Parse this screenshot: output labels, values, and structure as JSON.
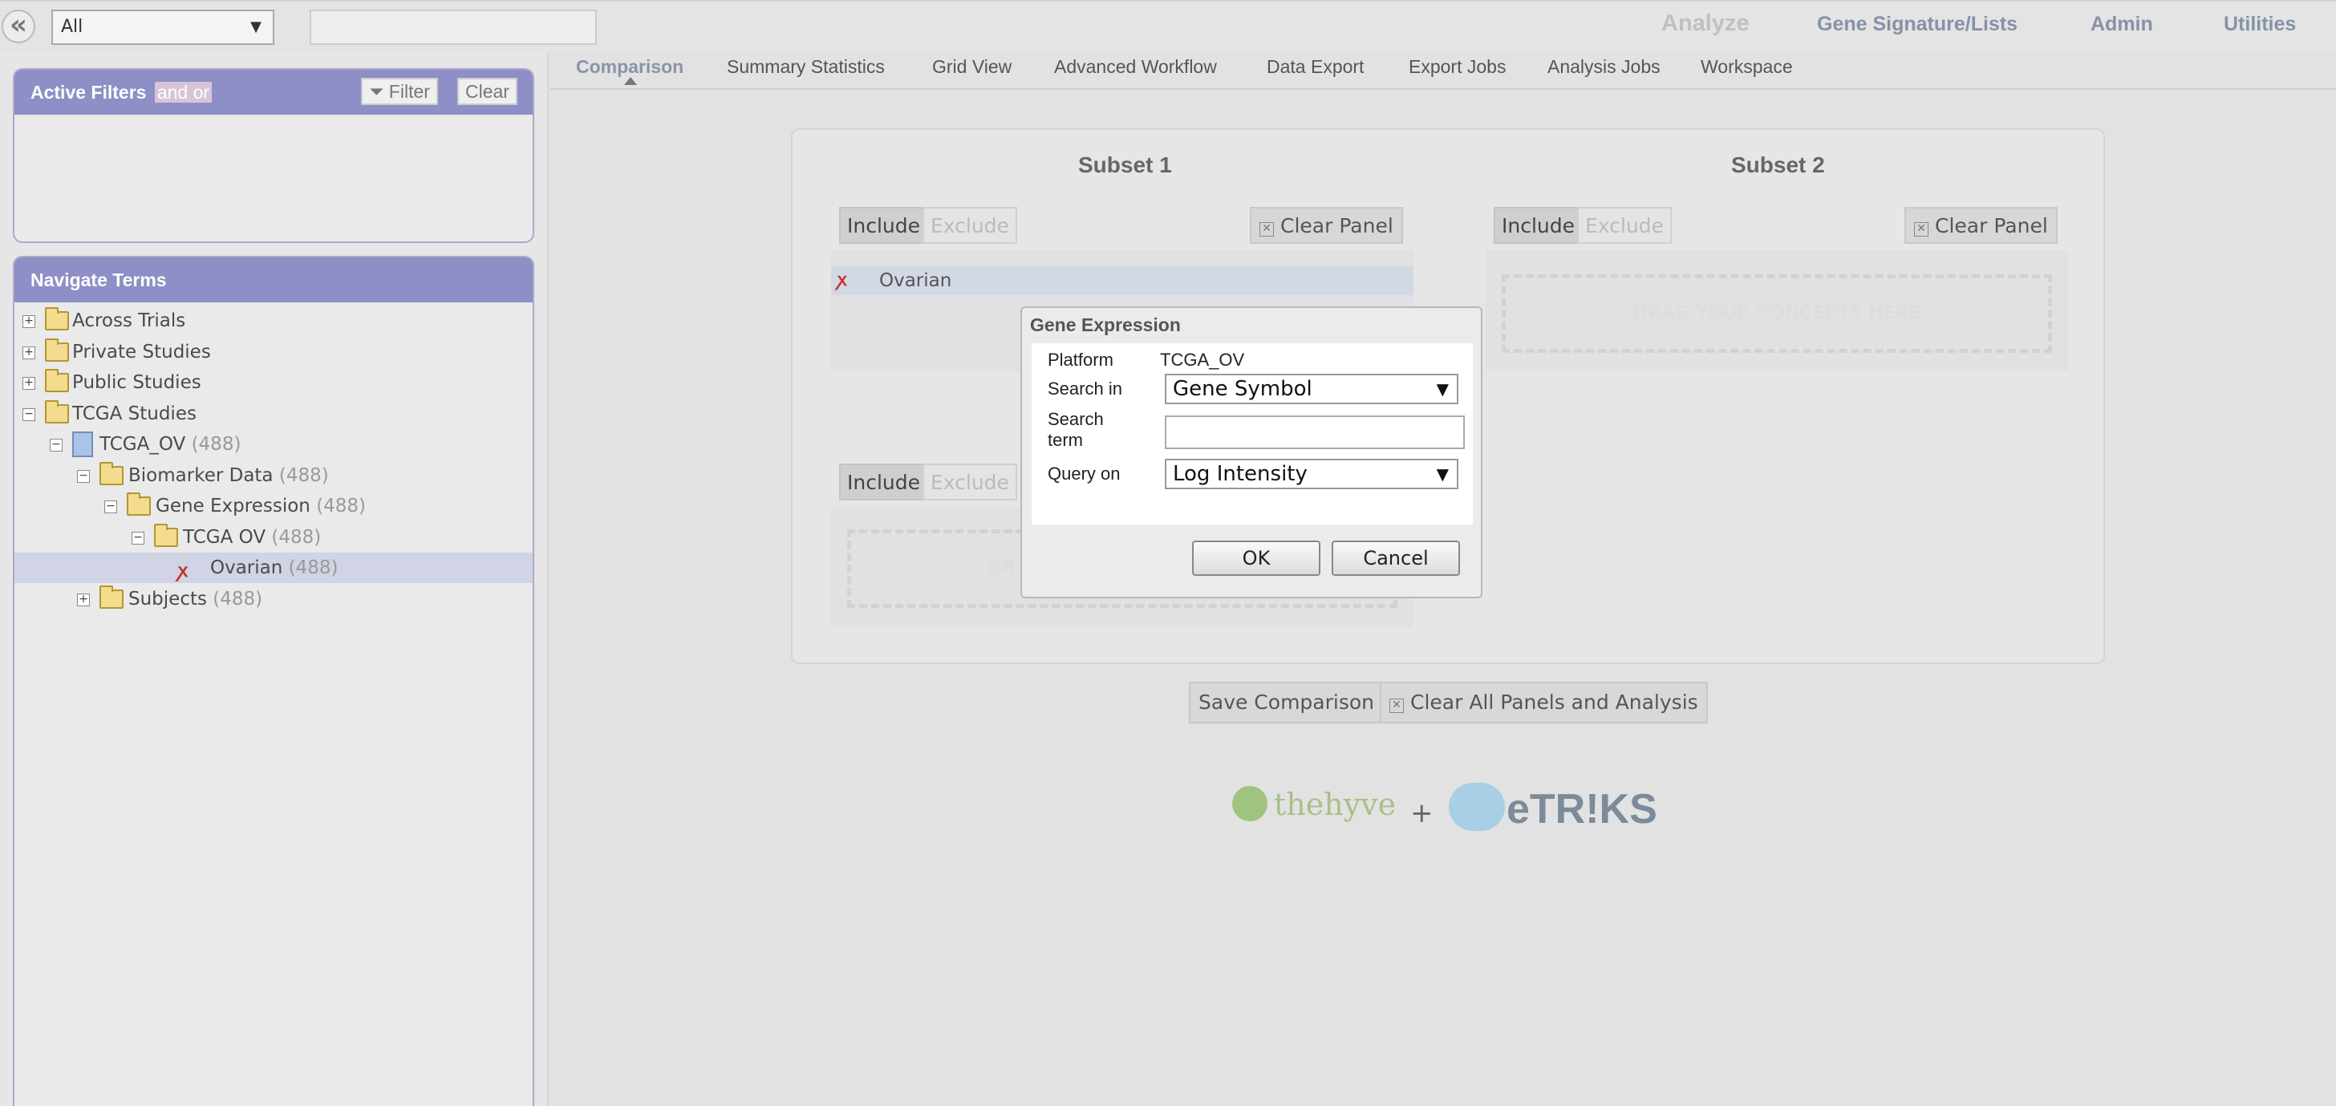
{
  "topbar": {
    "collapse_glyph": "«",
    "category_select": "All",
    "nav": {
      "analyze": "Analyze",
      "gene_signature": "Gene Signature/Lists",
      "admin": "Admin",
      "utilities": "Utilities"
    }
  },
  "active_filters": {
    "title": "Active Filters",
    "andor": "and or",
    "filter_btn": "Filter",
    "clear_btn": "Clear"
  },
  "navigate_terms": {
    "title": "Navigate Terms",
    "tree": [
      {
        "label": "Across Trials",
        "count": ""
      },
      {
        "label": "Private Studies",
        "count": ""
      },
      {
        "label": "Public Studies",
        "count": ""
      },
      {
        "label": "TCGA Studies",
        "count": ""
      },
      {
        "label": "TCGA_OV",
        "count": "(488)"
      },
      {
        "label": "Biomarker Data",
        "count": "(488)"
      },
      {
        "label": "Gene Expression",
        "count": "(488)"
      },
      {
        "label": "TCGA OV",
        "count": "(488)"
      },
      {
        "label": "Ovarian",
        "count": "(488)"
      },
      {
        "label": "Subjects",
        "count": "(488)"
      }
    ]
  },
  "tabs": [
    "Comparison",
    "Summary Statistics",
    "Grid View",
    "Advanced Workflow",
    "Data Export",
    "Export Jobs",
    "Analysis Jobs",
    "Workspace"
  ],
  "comparison": {
    "subset1": "Subset 1",
    "subset2": "Subset 2",
    "include": "Include",
    "exclude": "Exclude",
    "clear_panel": "Clear Panel",
    "concept": "Ovarian",
    "dropzone": "DRAG YOUR CONCEPTS HERE",
    "dropzone_partial": "DR"
  },
  "actions": {
    "save": "Save Comparison",
    "clear_all": "Clear All Panels and Analysis"
  },
  "logos": {
    "thehyve": "thehyve",
    "plus": "+",
    "etriks": "eTR!KS"
  },
  "dialog": {
    "title": "Gene Expression",
    "platform_label": "Platform",
    "platform_value": "TCGA_OV",
    "search_in_label": "Search in",
    "search_in_value": "Gene Symbol",
    "search_term_label_1": "Search",
    "search_term_label_2": "term",
    "search_term_value": "",
    "query_on_label": "Query on",
    "query_on_value": "Log Intensity",
    "ok": "OK",
    "cancel": "Cancel"
  }
}
